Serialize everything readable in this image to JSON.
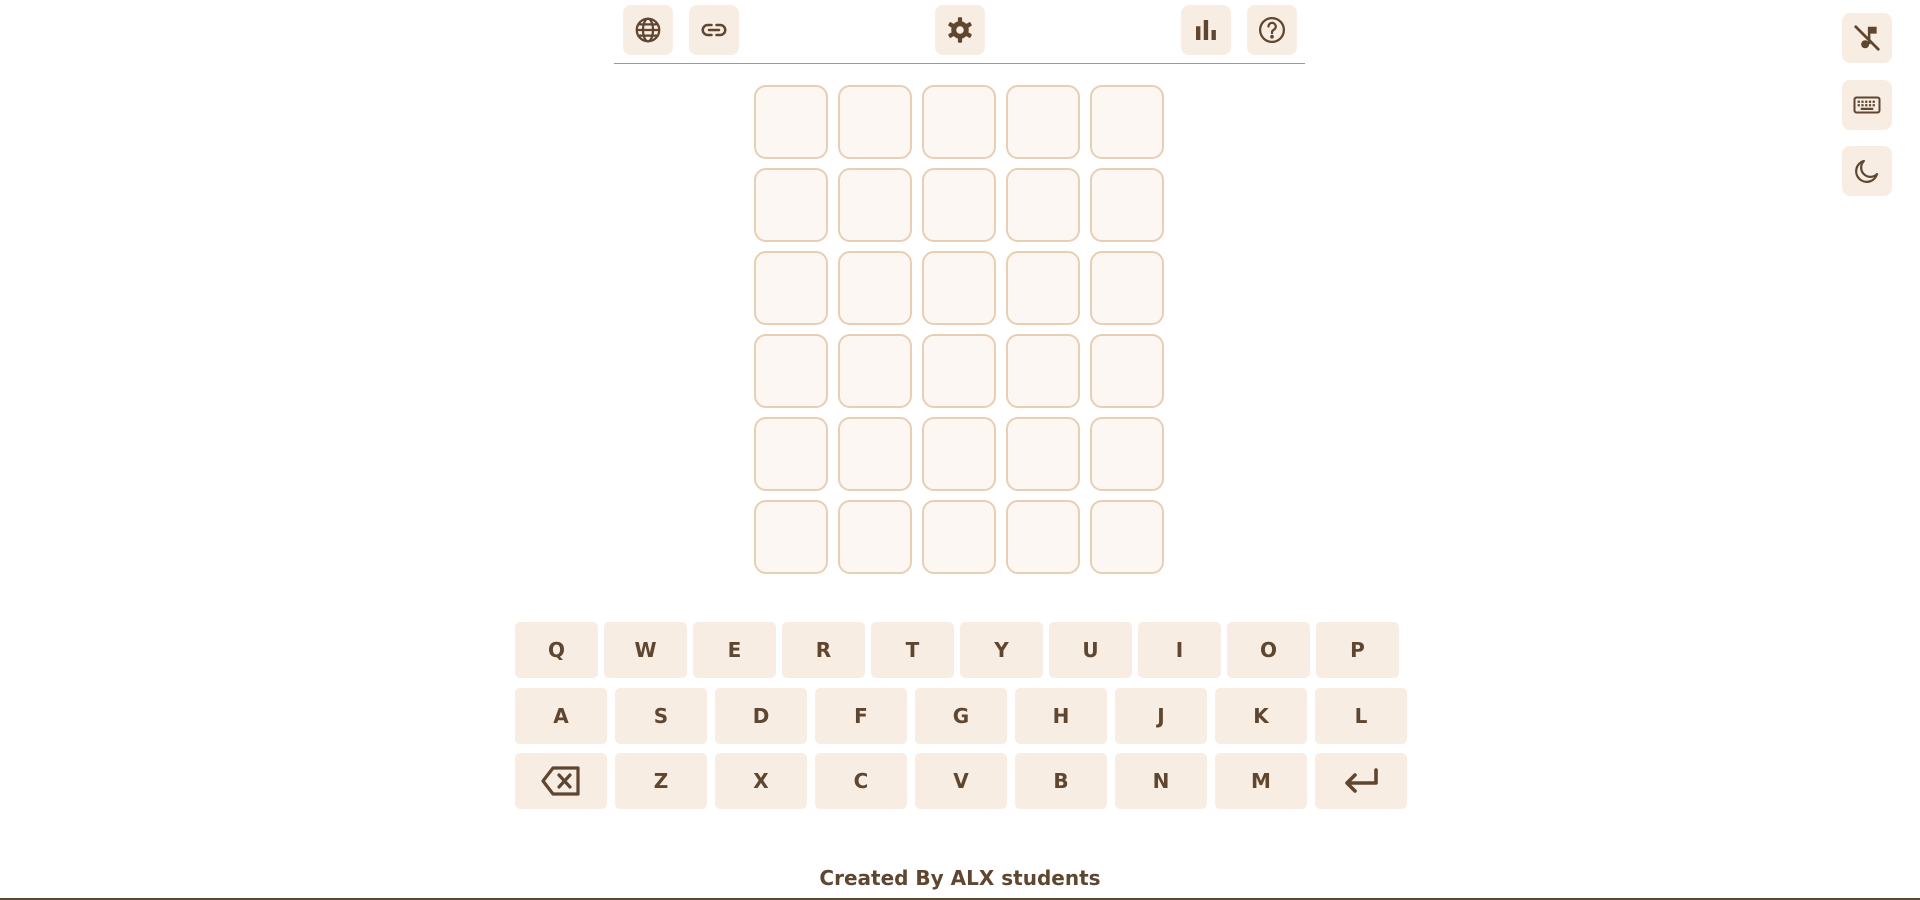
{
  "header": {
    "buttons": [
      {
        "name": "language-button",
        "icon": "globe-icon"
      },
      {
        "name": "share-link-button",
        "icon": "link-icon"
      },
      {
        "name": "settings-button",
        "icon": "gear-icon"
      },
      {
        "name": "statistics-button",
        "icon": "bar-chart-icon"
      },
      {
        "name": "help-button",
        "icon": "question-circle-icon"
      }
    ]
  },
  "side_controls": [
    {
      "name": "sound-toggle-button",
      "icon": "music-off-icon"
    },
    {
      "name": "keyboard-toggle-button",
      "icon": "keyboard-icon"
    },
    {
      "name": "dark-mode-toggle-button",
      "icon": "moon-icon"
    }
  ],
  "board": {
    "rows": [
      [
        "",
        "",
        "",
        "",
        ""
      ],
      [
        "",
        "",
        "",
        "",
        ""
      ],
      [
        "",
        "",
        "",
        "",
        ""
      ],
      [
        "",
        "",
        "",
        "",
        ""
      ],
      [
        "",
        "",
        "",
        "",
        ""
      ],
      [
        "",
        "",
        "",
        "",
        ""
      ]
    ]
  },
  "keyboard": {
    "row1": [
      "Q",
      "W",
      "E",
      "R",
      "T",
      "Y",
      "U",
      "I",
      "O",
      "P"
    ],
    "row2": [
      "A",
      "S",
      "D",
      "F",
      "G",
      "H",
      "J",
      "K",
      "L"
    ],
    "row3": [
      "Z",
      "X",
      "C",
      "V",
      "B",
      "N",
      "M"
    ],
    "backspace_icon": "backspace-icon",
    "enter_icon": "enter-icon"
  },
  "colors": {
    "accent_brown": "#5e4630",
    "key_background": "#f8ede3",
    "tile_border": "#e8cfb4",
    "tile_background": "#fcf7f3"
  },
  "footer": {
    "credit": "Created By ALX students"
  }
}
